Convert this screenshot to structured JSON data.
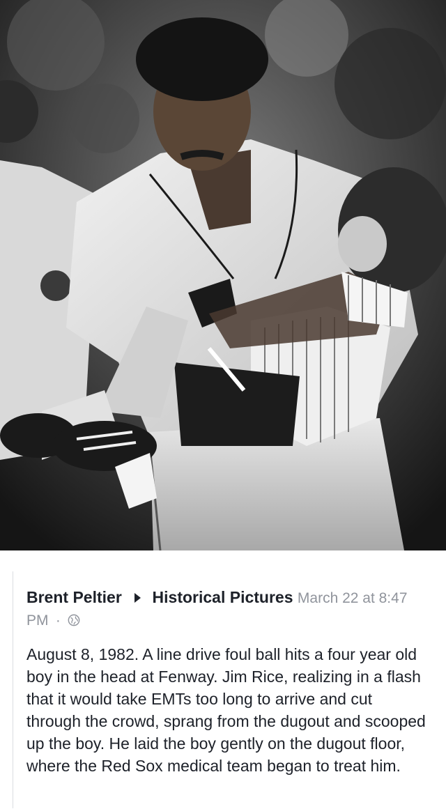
{
  "post": {
    "author": "Brent Peltier",
    "group": "Historical Pictures",
    "timestamp": "March 22 at 8:47 PM",
    "separator": "·",
    "privacy_icon": "globe-icon",
    "text": "August 8, 1982. A line drive foul ball hits a four year old boy in the head at Fenway. Jim Rice, realizing in a flash that it would take EMTs too long to arrive and cut through the crowd, sprang from the dugout and scooped up the boy. He laid the boy gently on the dugout floor, where the Red Sox medical team began to treat him."
  },
  "photo": {
    "description_icon": "black-and-white-photo",
    "colors": {
      "dark": "#1a1a1a",
      "mid": "#6b6b6b",
      "light": "#e6e6e6"
    }
  }
}
